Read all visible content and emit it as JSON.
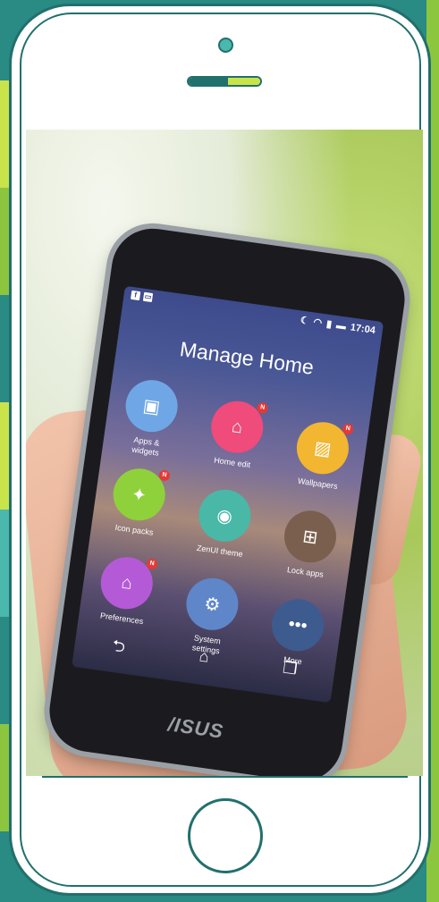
{
  "colors": {
    "frame": "#21706c",
    "accent_green": "#c9e34a",
    "accent_teal": "#4bb8ae"
  },
  "status_bar": {
    "left_icons": [
      "facebook-icon",
      "image-icon"
    ],
    "right_icons": [
      "moon-icon",
      "wifi-icon",
      "signal-icon",
      "battery-icon"
    ],
    "time": "17:04"
  },
  "screen": {
    "title": "Manage Home"
  },
  "apps": [
    {
      "label": "Apps &\nwidgets",
      "icon": "apps-widgets-icon",
      "color": "#6fa7e6",
      "badge": ""
    },
    {
      "label": "Home edit",
      "icon": "home-edit-icon",
      "color": "#ef4b7b",
      "badge": "N"
    },
    {
      "label": "Wallpapers",
      "icon": "wallpaper-icon",
      "color": "#f2b630",
      "badge": "N"
    },
    {
      "label": "Icon packs",
      "icon": "icon-packs-icon",
      "color": "#8fd13a",
      "badge": "N"
    },
    {
      "label": "ZenUI theme",
      "icon": "palette-icon",
      "color": "#49b8a7",
      "badge": ""
    },
    {
      "label": "Lock apps",
      "icon": "lock-apps-icon",
      "color": "#7a5f4e",
      "badge": ""
    },
    {
      "label": "Preferences",
      "icon": "preferences-icon",
      "color": "#b55ad6",
      "badge": "N"
    },
    {
      "label": "System\nsettings",
      "icon": "gear-icon",
      "color": "#5f86c9",
      "badge": ""
    },
    {
      "label": "More",
      "icon": "more-icon",
      "color": "#3e5b8f",
      "badge": ""
    }
  ],
  "nav": {
    "back": "⮌",
    "home": "⌂",
    "recent": "❐"
  },
  "brand": "/ISUS"
}
